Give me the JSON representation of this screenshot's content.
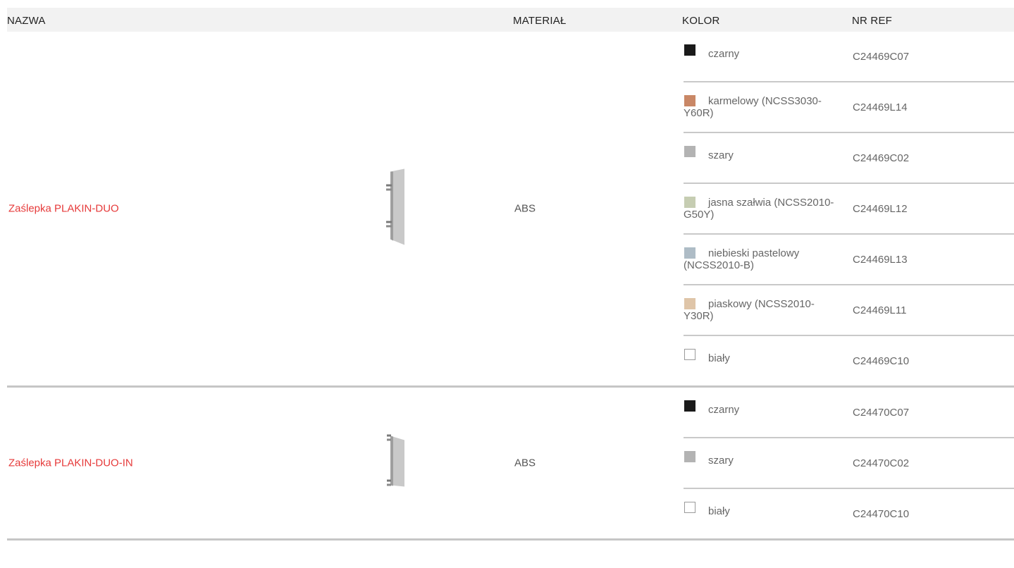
{
  "header": {
    "name": "NAZWA",
    "material": "MATERIAŁ",
    "color": "KOLOR",
    "ref": "NR REF"
  },
  "products": [
    {
      "name": "Zaślepka PLAKIN-DUO",
      "material": "ABS",
      "variants": [
        {
          "color": "czarny",
          "swatch": "#1a1a1a",
          "ref": "C24469C07"
        },
        {
          "color": "karmelowy (NCSS3030-Y60R)",
          "swatch": "#c98766",
          "ref": "C24469L14"
        },
        {
          "color": "szary",
          "swatch": "#b3b3b3",
          "ref": "C24469C02"
        },
        {
          "color": "jasna szałwia (NCSS2010-G50Y)",
          "swatch": "#c6cdb2",
          "ref": "C24469L12"
        },
        {
          "color": "niebieski pastelowy (NCSS2010-B)",
          "swatch": "#aebcc6",
          "ref": "C24469L13"
        },
        {
          "color": "piaskowy (NCSS2010-Y30R)",
          "swatch": "#dfc5a8",
          "ref": "C24469L11"
        },
        {
          "color": "biały",
          "swatch": "#ffffff",
          "ref": "C24469C10"
        }
      ]
    },
    {
      "name": "Zaślepka PLAKIN-DUO-IN",
      "material": "ABS",
      "variants": [
        {
          "color": "czarny",
          "swatch": "#1a1a1a",
          "ref": "C24470C07"
        },
        {
          "color": "szary",
          "swatch": "#b3b3b3",
          "ref": "C24470C02"
        },
        {
          "color": "biały",
          "swatch": "#ffffff",
          "ref": "C24470C10"
        }
      ]
    }
  ]
}
